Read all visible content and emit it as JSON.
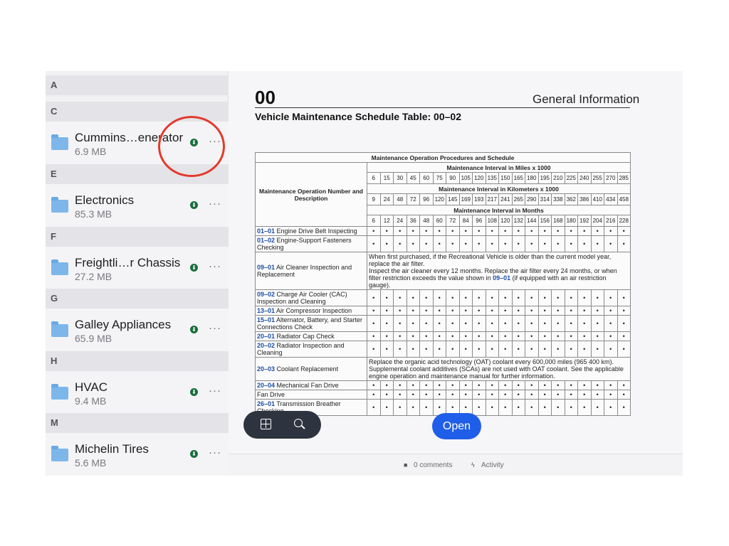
{
  "sidebar": {
    "sections": [
      {
        "letter": "A"
      },
      {
        "letter": "C"
      },
      {
        "letter": "E"
      },
      {
        "letter": "F"
      },
      {
        "letter": "G"
      },
      {
        "letter": "H"
      },
      {
        "letter": "M"
      }
    ],
    "files": [
      {
        "name": "Cummins…enerator",
        "size": "6.9 MB"
      },
      {
        "name": "Electronics",
        "size": "85.3 MB"
      },
      {
        "name": "Freightli…r Chassis",
        "size": "27.2 MB"
      },
      {
        "name": "Galley Appliances",
        "size": "65.9 MB"
      },
      {
        "name": "HVAC",
        "size": "9.4 MB"
      },
      {
        "name": "Michelin Tires",
        "size": "5.6 MB"
      }
    ],
    "more_glyph": "···",
    "download_glyph": "⬇"
  },
  "document": {
    "number": "00",
    "section": "General Information",
    "subtitle": "Vehicle Maintenance Schedule Table: 00–02",
    "table": {
      "title": "Maintenance Operation Procedures and Schedule",
      "op_header": "Maintenance Operation Number and Description",
      "miles_header": "Maintenance Interval in Miles x 1000",
      "km_header": "Maintenance Interval in Kilometers x 1000",
      "months_header": "Maintenance Interval in Months",
      "miles": [
        "6",
        "15",
        "30",
        "45",
        "60",
        "75",
        "90",
        "105",
        "120",
        "135",
        "150",
        "165",
        "180",
        "195",
        "210",
        "225",
        "240",
        "255",
        "270",
        "285"
      ],
      "km": [
        "9",
        "24",
        "48",
        "72",
        "96",
        "120",
        "145",
        "169",
        "193",
        "217",
        "241",
        "265",
        "290",
        "314",
        "338",
        "362",
        "386",
        "410",
        "434",
        "458"
      ],
      "months": [
        "6",
        "12",
        "24",
        "36",
        "48",
        "60",
        "72",
        "84",
        "96",
        "108",
        "120",
        "132",
        "144",
        "156",
        "168",
        "180",
        "192",
        "204",
        "216",
        "228"
      ],
      "rows": [
        {
          "code": "01–01",
          "desc": "Engine Drive Belt Inspecting"
        },
        {
          "code": "01–02",
          "desc": "Engine-Support Fasteners Checking"
        },
        {
          "code": "09–01",
          "desc": "Air Cleaner Inspection and Replacement",
          "note_a": "When first purchased, if the Recreational Vehicle is older than the current model year, replace the air filter.",
          "note_b": "Inspect the air cleaner every 12 months. Replace the air filter every 24 months, or when filter restriction exceeds the value shown in ",
          "note_code": "09–01",
          "note_c": " (if equipped with an air restriction gauge)."
        },
        {
          "code": "09–02",
          "desc": "Charge Air Cooler (CAC) Inspection and Cleaning"
        },
        {
          "code": "13–01",
          "desc": "Air Compressor Inspection"
        },
        {
          "code": "15–01",
          "desc": "Alternator, Battery, and Starter Connections Check"
        },
        {
          "code": "20–01",
          "desc": "Radiator Cap Check"
        },
        {
          "code": "20–02",
          "desc": "Radiator Inspection and Cleaning"
        },
        {
          "code": "20–03",
          "desc": "Coolant Replacement",
          "note_a": "Replace the organic acid technology (OAT) coolant every 600,000 miles (965 400 km). Supplemental coolant additives (SCAs) are not used with OAT coolant. See the applicable engine operation and maintenance manual for further information."
        },
        {
          "code": "20–04",
          "desc": "Mechanical Fan Drive"
        },
        {
          "code": "",
          "desc": "Fan Drive"
        },
        {
          "code": "26–01",
          "desc": "Transmission Breather Checking"
        }
      ],
      "dot": "•"
    }
  },
  "toolbar": {
    "open_label": "Open"
  },
  "footer": {
    "comments": "0 comments",
    "activity": "Activity"
  }
}
